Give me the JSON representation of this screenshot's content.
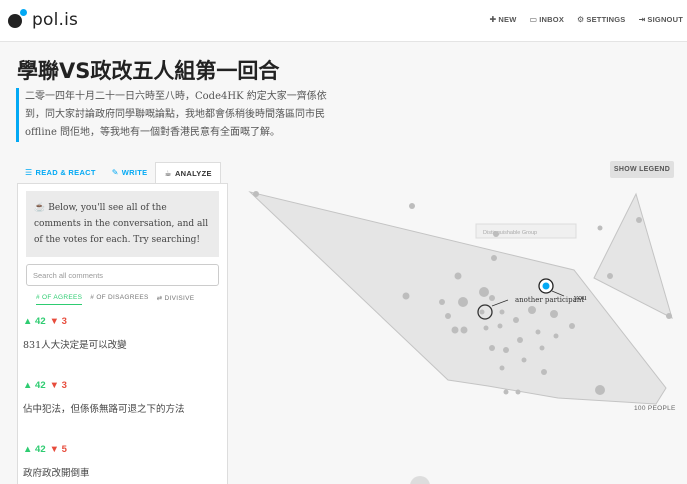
{
  "brand": {
    "name": "pol.is"
  },
  "nav": [
    {
      "icon": "plus-square-icon",
      "glyph": "✚",
      "label": "NEW"
    },
    {
      "icon": "inbox-icon",
      "glyph": "▭",
      "label": "INBOX"
    },
    {
      "icon": "gear-icon",
      "glyph": "⚙",
      "label": "SETTINGS"
    },
    {
      "icon": "signout-icon",
      "glyph": "⇥",
      "label": "SIGNOUT"
    }
  ],
  "conversation": {
    "title": "學聯VS政改五人組第一回合",
    "description": "二零一四年十月二十一日六時至八時，Code4HK 約定大家一齊係依到，同大家討論政府同學聯嘅論點，我地都會係稍後時間落區同市民offline 問佢地，等我地有一個對香港民意有全面嘅了解。"
  },
  "tabs": [
    {
      "icon": "list-icon",
      "glyph": "☰",
      "label": "READ & REACT",
      "active": false
    },
    {
      "icon": "pencil-icon",
      "glyph": "✎",
      "label": "WRITE",
      "active": false
    },
    {
      "icon": "coffee-icon",
      "glyph": "☕",
      "label": "ANALYZE",
      "active": true
    }
  ],
  "analyze": {
    "info_icon": "coffee-icon",
    "info_glyph": "☕",
    "info_text": "Below, you'll see all of the comments in the conversation, and all of the votes for each. Try searching!",
    "search_placeholder": "Search all comments",
    "sorts": [
      {
        "label": "# OF AGREES",
        "active": true
      },
      {
        "label": "# OF DISAGREES",
        "active": false
      },
      {
        "label": "⇄ DIVISIVE",
        "active": false
      }
    ]
  },
  "comments": [
    {
      "agree": "▲ 42",
      "disagree": "▼ 3",
      "text": "831人大決定是可以改變"
    },
    {
      "agree": "▲ 42",
      "disagree": "▼ 3",
      "text": "佔中犯法，但係係無路可退之下的方法"
    },
    {
      "agree": "▲ 42",
      "disagree": "▼ 5",
      "text": "政府政改開倒車"
    }
  ],
  "visualization": {
    "show_legend_label": "SHOW LEGEND",
    "people_count_label": "100 PEOPLE",
    "tooltip_label": "Distinguishable Group",
    "another_participant_label": "another participant",
    "you_label": "you"
  }
}
